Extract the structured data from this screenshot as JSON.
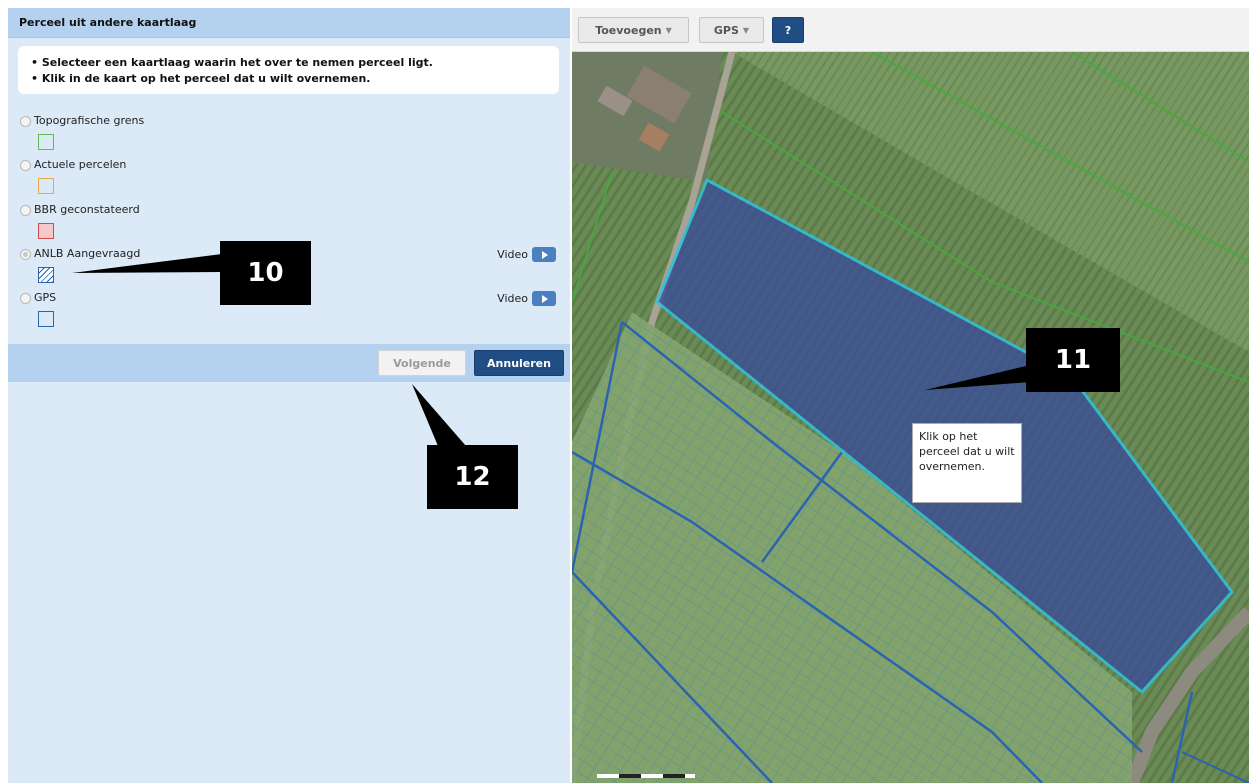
{
  "panel": {
    "title": "Perceel uit andere kaartlaag",
    "instructions": [
      "• Selecteer een kaartlaag waarin het over te nemen perceel ligt.",
      "• Klik in de kaart op het perceel dat u wilt overnemen."
    ],
    "layers": [
      {
        "label": "Topografische grens",
        "swatch_color": "#5fbf4a",
        "selected": false,
        "video": null
      },
      {
        "label": "Actuele percelen",
        "swatch_color": "#e8a84a",
        "selected": false,
        "video": null
      },
      {
        "label": "BBR geconstateerd",
        "swatch_color": "#d44a4a",
        "selected": false,
        "video": null
      },
      {
        "label": "ANLB Aangevraagd",
        "swatch_color": "#2a64b0",
        "selected": true,
        "video": "Video"
      },
      {
        "label": "GPS",
        "swatch_color": "#2a64b0",
        "selected": false,
        "video": "Video"
      }
    ],
    "next_label": "Volgende",
    "cancel_label": "Annuleren"
  },
  "toolbar": {
    "add_label": "Toevoegen",
    "gps_label": "GPS",
    "help_label": "?"
  },
  "map": {
    "tooltip": "Klik op het perceel dat u wilt overnemen.",
    "selected_parcel_color": "#3b4f96",
    "outline_color": "#2cc4e0"
  },
  "callouts": {
    "c10": "10",
    "c11": "11",
    "c12": "12"
  },
  "colors": {
    "panel_bg": "#dce9f7",
    "header_bg": "#b4d2ef",
    "primary_button": "#1f4d84"
  }
}
